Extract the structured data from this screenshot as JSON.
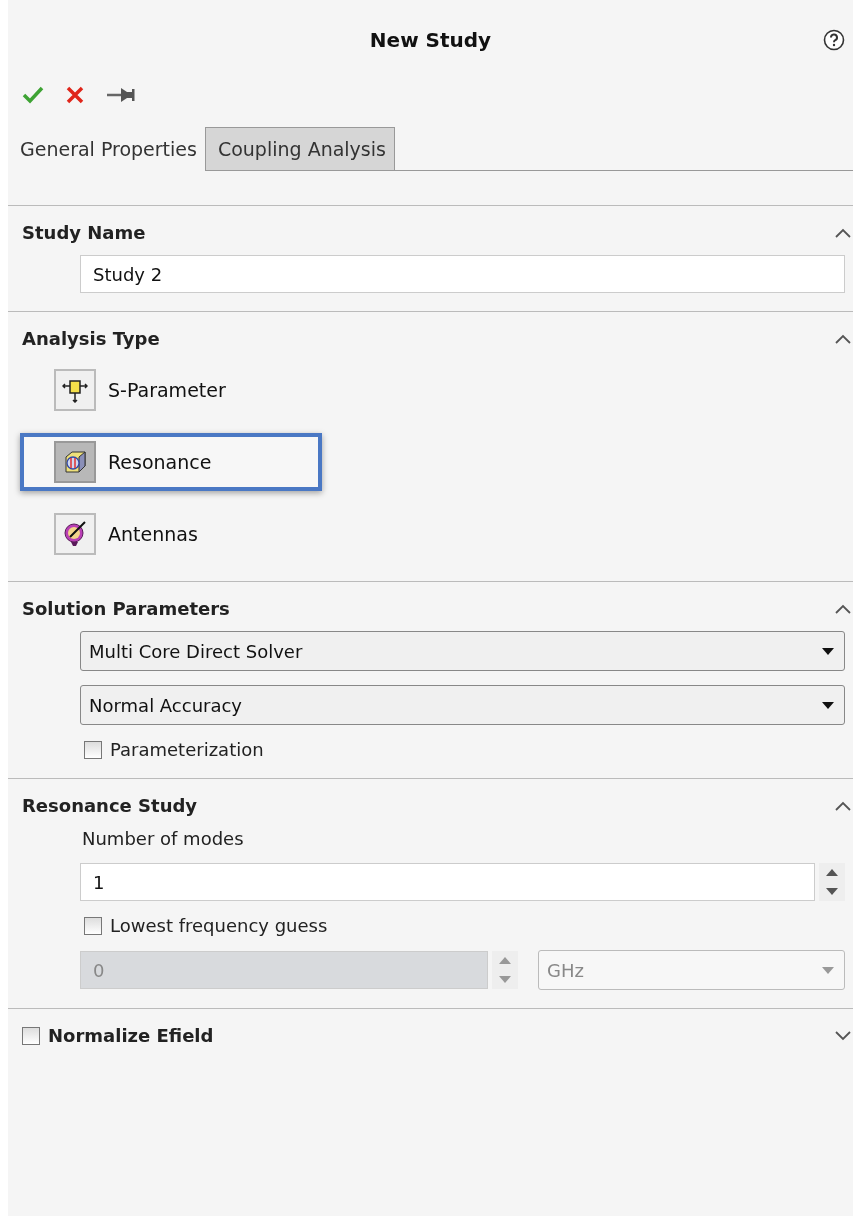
{
  "panel": {
    "title": "New Study"
  },
  "tabs": [
    {
      "label": "General Properties",
      "selected": true
    },
    {
      "label": "Coupling Analysis",
      "selected": false
    }
  ],
  "sections": [
    {
      "kind": "name",
      "title": "Study Name",
      "expanded": true,
      "value": "Study 2"
    },
    {
      "kind": "analysis",
      "title": "Analysis Type",
      "expanded": true,
      "options": [
        {
          "label": "S-Parameter",
          "selected": false
        },
        {
          "label": "Resonance",
          "selected": true
        },
        {
          "label": "Antennas",
          "selected": false
        }
      ]
    },
    {
      "kind": "solution",
      "title": "Solution Parameters",
      "expanded": true,
      "dropdowns": [
        "Multi Core Direct Solver",
        "Normal Accuracy"
      ],
      "checkbox": {
        "label": "Parameterization",
        "checked": false
      }
    },
    {
      "kind": "resonance",
      "title": "Resonance Study",
      "expanded": true,
      "modes_label": "Number of modes",
      "modes_value": "1",
      "guess": {
        "label": "Lowest frequency guess",
        "checked": false
      },
      "frequency": {
        "value": "0",
        "disabled": true
      },
      "unit": {
        "value": "GHz",
        "disabled": true
      }
    },
    {
      "kind": "check",
      "title": "Normalize Efield",
      "expanded": false,
      "checked": false
    }
  ]
}
